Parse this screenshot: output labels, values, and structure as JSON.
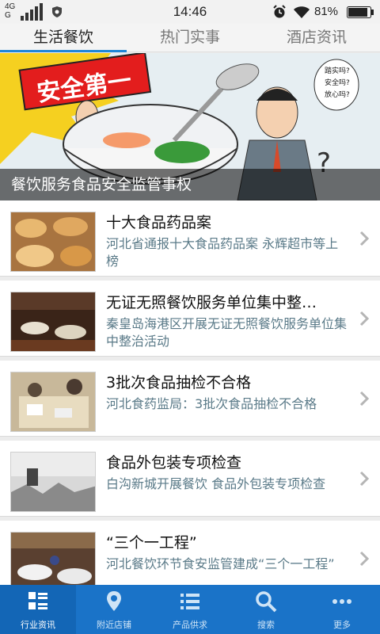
{
  "status_bar": {
    "network_top": "4G",
    "network_bottom": "G",
    "time": "14:46",
    "battery": "81%"
  },
  "tabs": [
    {
      "label": "生活餐饮",
      "active": true
    },
    {
      "label": "热门实事",
      "active": false
    },
    {
      "label": "酒店资讯",
      "active": false
    }
  ],
  "banner": {
    "caption": "餐饮服务食品安全监管事权",
    "sign_text": "安全第一",
    "bubble_lines": [
      "踏实吗?",
      "安全吗?",
      "放心吗?"
    ]
  },
  "news": [
    {
      "title": "十大食品药品案",
      "desc": "河北省通报十大食品药品案 永辉超市等上榜",
      "thumb": "dim-sum-icon"
    },
    {
      "title": "无证无照餐饮服务单位集中整…",
      "desc": "秦皇岛海港区开展无证无照餐饮服务单位集中整治活动",
      "thumb": "restaurant-hall-icon"
    },
    {
      "title": "3批次食品抽检不合格",
      "desc": "河北食药监局：3批次食品抽检不合格",
      "thumb": "inspection-icon"
    },
    {
      "title": "食品外包装专项检查",
      "desc": "白沟新城开展餐饮 食品外包装专项检查",
      "thumb": "demolition-site-icon"
    },
    {
      "title": "“三个一工程”",
      "desc": "河北餐饮环节食安监管建成“三个一工程”",
      "thumb": "banquet-hall-icon"
    }
  ],
  "bottom_nav": [
    {
      "label": "行业资讯",
      "icon": "grid-list-icon",
      "active": true
    },
    {
      "label": "附近店铺",
      "icon": "map-pin-icon",
      "active": false
    },
    {
      "label": "产品供求",
      "icon": "list-icon",
      "active": false
    },
    {
      "label": "搜索",
      "icon": "search-icon",
      "active": false
    },
    {
      "label": "更多",
      "icon": "more-icon",
      "active": false
    }
  ],
  "colors": {
    "accent": "#1e86d6",
    "bottom_nav_bg": "#1a73c8",
    "desc_text": "#5a7a88"
  }
}
